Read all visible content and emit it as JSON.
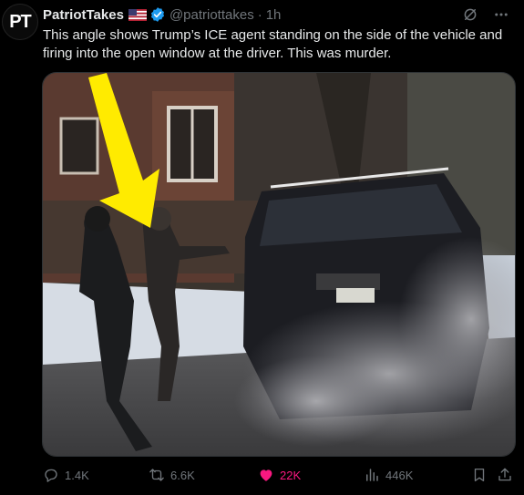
{
  "author": {
    "avatar_text": "PT",
    "name": "PatriotTakes",
    "handle": "@patriottakes",
    "time": "1h"
  },
  "tweet_text": "This angle shows Trump’s ICE agent standing on the side of the vehicle and firing into the open window at the driver. This was murder.",
  "metrics": {
    "replies": "1.4K",
    "retweets": "6.6K",
    "likes": "22K",
    "views": "446K"
  },
  "colors": {
    "like": "#f91880",
    "verified": "#1d9bf0",
    "muted": "#71767b"
  },
  "icons": [
    "grok-icon",
    "more-icon",
    "reply-icon",
    "retweet-icon",
    "like-icon",
    "views-icon",
    "bookmark-icon",
    "share-icon"
  ]
}
